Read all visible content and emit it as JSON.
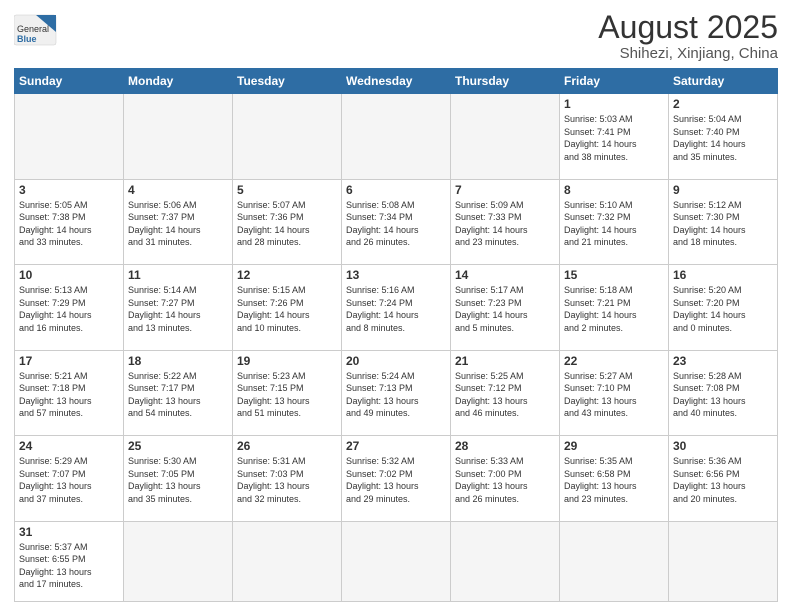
{
  "header": {
    "logo_general": "General",
    "logo_blue": "Blue",
    "month_year": "August 2025",
    "location": "Shihezi, Xinjiang, China"
  },
  "weekdays": [
    "Sunday",
    "Monday",
    "Tuesday",
    "Wednesday",
    "Thursday",
    "Friday",
    "Saturday"
  ],
  "days": [
    {
      "num": "",
      "info": "",
      "empty": true
    },
    {
      "num": "",
      "info": "",
      "empty": true
    },
    {
      "num": "",
      "info": "",
      "empty": true
    },
    {
      "num": "",
      "info": "",
      "empty": true
    },
    {
      "num": "",
      "info": "",
      "empty": true
    },
    {
      "num": "1",
      "info": "Sunrise: 5:03 AM\nSunset: 7:41 PM\nDaylight: 14 hours\nand 38 minutes."
    },
    {
      "num": "2",
      "info": "Sunrise: 5:04 AM\nSunset: 7:40 PM\nDaylight: 14 hours\nand 35 minutes."
    },
    {
      "num": "3",
      "info": "Sunrise: 5:05 AM\nSunset: 7:38 PM\nDaylight: 14 hours\nand 33 minutes."
    },
    {
      "num": "4",
      "info": "Sunrise: 5:06 AM\nSunset: 7:37 PM\nDaylight: 14 hours\nand 31 minutes."
    },
    {
      "num": "5",
      "info": "Sunrise: 5:07 AM\nSunset: 7:36 PM\nDaylight: 14 hours\nand 28 minutes."
    },
    {
      "num": "6",
      "info": "Sunrise: 5:08 AM\nSunset: 7:34 PM\nDaylight: 14 hours\nand 26 minutes."
    },
    {
      "num": "7",
      "info": "Sunrise: 5:09 AM\nSunset: 7:33 PM\nDaylight: 14 hours\nand 23 minutes."
    },
    {
      "num": "8",
      "info": "Sunrise: 5:10 AM\nSunset: 7:32 PM\nDaylight: 14 hours\nand 21 minutes."
    },
    {
      "num": "9",
      "info": "Sunrise: 5:12 AM\nSunset: 7:30 PM\nDaylight: 14 hours\nand 18 minutes."
    },
    {
      "num": "10",
      "info": "Sunrise: 5:13 AM\nSunset: 7:29 PM\nDaylight: 14 hours\nand 16 minutes."
    },
    {
      "num": "11",
      "info": "Sunrise: 5:14 AM\nSunset: 7:27 PM\nDaylight: 14 hours\nand 13 minutes."
    },
    {
      "num": "12",
      "info": "Sunrise: 5:15 AM\nSunset: 7:26 PM\nDaylight: 14 hours\nand 10 minutes."
    },
    {
      "num": "13",
      "info": "Sunrise: 5:16 AM\nSunset: 7:24 PM\nDaylight: 14 hours\nand 8 minutes."
    },
    {
      "num": "14",
      "info": "Sunrise: 5:17 AM\nSunset: 7:23 PM\nDaylight: 14 hours\nand 5 minutes."
    },
    {
      "num": "15",
      "info": "Sunrise: 5:18 AM\nSunset: 7:21 PM\nDaylight: 14 hours\nand 2 minutes."
    },
    {
      "num": "16",
      "info": "Sunrise: 5:20 AM\nSunset: 7:20 PM\nDaylight: 14 hours\nand 0 minutes."
    },
    {
      "num": "17",
      "info": "Sunrise: 5:21 AM\nSunset: 7:18 PM\nDaylight: 13 hours\nand 57 minutes."
    },
    {
      "num": "18",
      "info": "Sunrise: 5:22 AM\nSunset: 7:17 PM\nDaylight: 13 hours\nand 54 minutes."
    },
    {
      "num": "19",
      "info": "Sunrise: 5:23 AM\nSunset: 7:15 PM\nDaylight: 13 hours\nand 51 minutes."
    },
    {
      "num": "20",
      "info": "Sunrise: 5:24 AM\nSunset: 7:13 PM\nDaylight: 13 hours\nand 49 minutes."
    },
    {
      "num": "21",
      "info": "Sunrise: 5:25 AM\nSunset: 7:12 PM\nDaylight: 13 hours\nand 46 minutes."
    },
    {
      "num": "22",
      "info": "Sunrise: 5:27 AM\nSunset: 7:10 PM\nDaylight: 13 hours\nand 43 minutes."
    },
    {
      "num": "23",
      "info": "Sunrise: 5:28 AM\nSunset: 7:08 PM\nDaylight: 13 hours\nand 40 minutes."
    },
    {
      "num": "24",
      "info": "Sunrise: 5:29 AM\nSunset: 7:07 PM\nDaylight: 13 hours\nand 37 minutes."
    },
    {
      "num": "25",
      "info": "Sunrise: 5:30 AM\nSunset: 7:05 PM\nDaylight: 13 hours\nand 35 minutes."
    },
    {
      "num": "26",
      "info": "Sunrise: 5:31 AM\nSunset: 7:03 PM\nDaylight: 13 hours\nand 32 minutes."
    },
    {
      "num": "27",
      "info": "Sunrise: 5:32 AM\nSunset: 7:02 PM\nDaylight: 13 hours\nand 29 minutes."
    },
    {
      "num": "28",
      "info": "Sunrise: 5:33 AM\nSunset: 7:00 PM\nDaylight: 13 hours\nand 26 minutes."
    },
    {
      "num": "29",
      "info": "Sunrise: 5:35 AM\nSunset: 6:58 PM\nDaylight: 13 hours\nand 23 minutes."
    },
    {
      "num": "30",
      "info": "Sunrise: 5:36 AM\nSunset: 6:56 PM\nDaylight: 13 hours\nand 20 minutes."
    },
    {
      "num": "31",
      "info": "Sunrise: 5:37 AM\nSunset: 6:55 PM\nDaylight: 13 hours\nand 17 minutes."
    },
    {
      "num": "",
      "info": "",
      "empty": true
    },
    {
      "num": "",
      "info": "",
      "empty": true
    },
    {
      "num": "",
      "info": "",
      "empty": true
    },
    {
      "num": "",
      "info": "",
      "empty": true
    },
    {
      "num": "",
      "info": "",
      "empty": true
    },
    {
      "num": "",
      "info": "",
      "empty": true
    }
  ]
}
